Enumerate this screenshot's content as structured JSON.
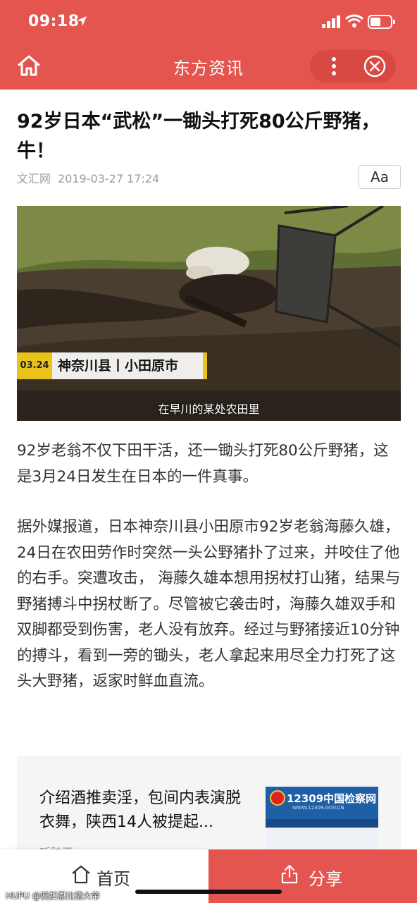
{
  "status_bar": {
    "time": "09:18"
  },
  "header": {
    "title": "东方资讯"
  },
  "article": {
    "title": "92岁日本“武松”一锄头打死80公斤野猪，牛！",
    "source": "文汇网",
    "datetime": "2019-03-27 17:24",
    "font_button": "Aa",
    "image": {
      "date_tag": "03.24",
      "location_tag": "神奈川县丨小田原市",
      "subtitle": "在早川的某处农田里"
    },
    "paragraphs": [
      "92岁老翁不仅下田干活，还一锄头打死80公斤野猪，这是3月24日发生在日本的一件真事。",
      "据外媒报道，日本神奈川县小田原市92岁老翁海藤久雄，24日在农田劳作时突然一头公野猪扑了过来，并咬住了他的右手。突遭攻击， 海藤久雄本想用拐杖打山猪，结果与野猪搏斗中拐杖断了。尽管被它袭击时，海藤久雄双手和双脚都受到伤害，老人没有放弃。经过与野猪接近10分钟的搏斗，看到一旁的锄头，老人拿起来用尽全力打死了这头大野猪，返家时鲜血直流。"
    ]
  },
  "related": {
    "title": "介绍酒推卖淫，包间内表演脱衣舞，陕西14人被提起...",
    "source": "听陕西",
    "thumb_title": "12309中国检察网",
    "thumb_url": "WWW.12309.GOV.CN"
  },
  "tabbar": {
    "home_label": "首页",
    "share_label": "分享"
  },
  "watermark": "HUPU @骑扣恩比德大帝",
  "colors": {
    "brand_red": "#e4554f",
    "tag_yellow": "#e9c21a"
  },
  "icons": [
    "location-arrow-icon",
    "signal-icon",
    "wifi-icon",
    "battery-icon",
    "home-icon",
    "more-icon",
    "close-icon",
    "share-icon"
  ]
}
